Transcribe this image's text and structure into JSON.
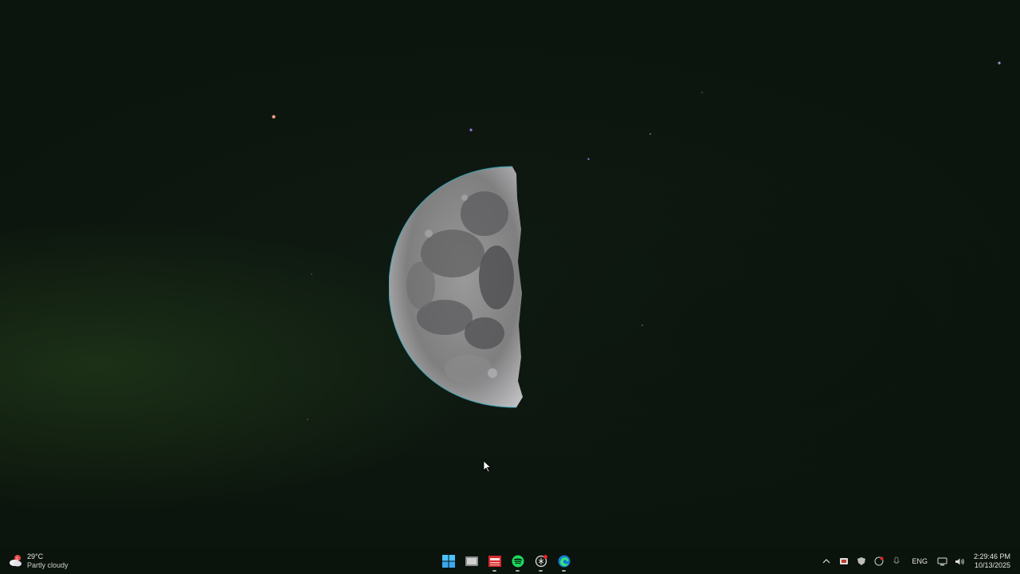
{
  "weather": {
    "temperature": "29°C",
    "condition": "Partly cloudy",
    "icon": "partly-cloudy-icon"
  },
  "taskbar": {
    "apps": [
      {
        "name": "start",
        "icon": "windows-start-icon"
      },
      {
        "name": "file-explorer",
        "icon": "file-explorer-icon"
      },
      {
        "name": "news-app",
        "icon": "news-icon"
      },
      {
        "name": "spotify",
        "icon": "spotify-icon"
      },
      {
        "name": "chatgpt",
        "icon": "chatgpt-icon"
      },
      {
        "name": "edge",
        "icon": "edge-browser-icon"
      }
    ]
  },
  "tray": {
    "language": "ENG",
    "time": "2:29:46 PM",
    "date": "10/13/2025"
  },
  "colors": {
    "spotify": "#1ed760",
    "start_blue": "#4cc2ff",
    "news_red": "#d6282b"
  }
}
